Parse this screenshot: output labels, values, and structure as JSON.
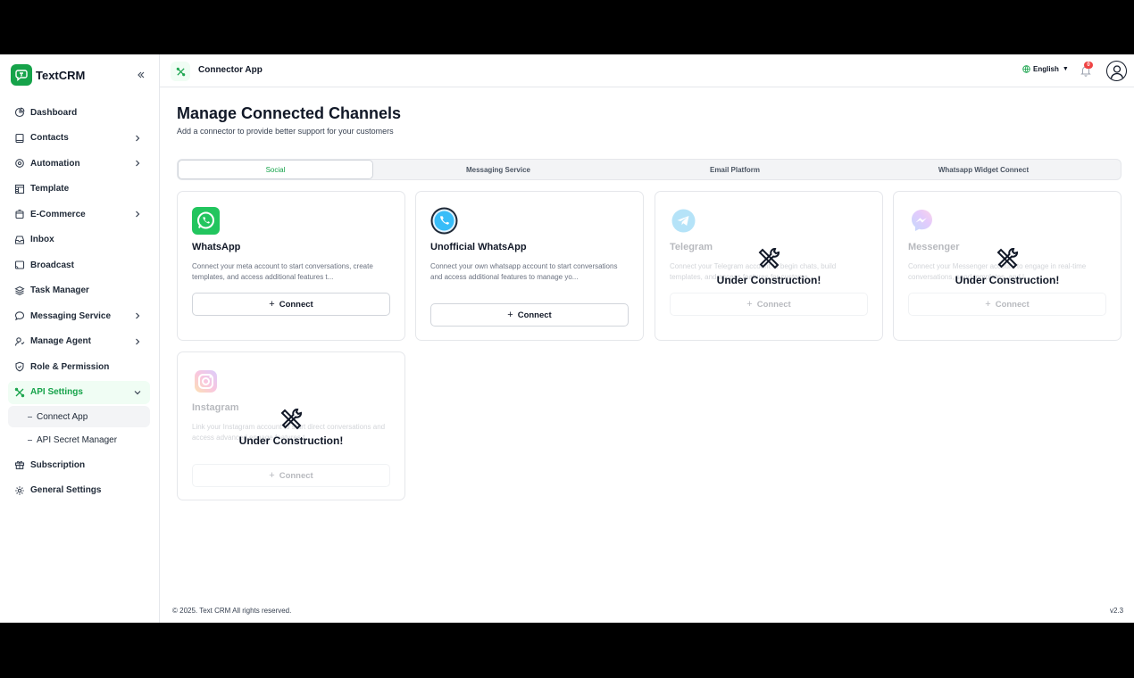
{
  "app": {
    "name": "TextCRM"
  },
  "sidebar": {
    "items": [
      {
        "label": "Dashboard",
        "icon": "dashboard-icon",
        "has_children": false
      },
      {
        "label": "Contacts",
        "icon": "contacts-icon",
        "has_children": true
      },
      {
        "label": "Automation",
        "icon": "automation-icon",
        "has_children": true
      },
      {
        "label": "Template",
        "icon": "template-icon",
        "has_children": false
      },
      {
        "label": "E-Commerce",
        "icon": "ecommerce-icon",
        "has_children": true
      },
      {
        "label": "Inbox",
        "icon": "inbox-icon",
        "has_children": false
      },
      {
        "label": "Broadcast",
        "icon": "broadcast-icon",
        "has_children": false
      },
      {
        "label": "Task Manager",
        "icon": "task-manager-icon",
        "has_children": false
      },
      {
        "label": "Messaging Service",
        "icon": "messaging-icon",
        "has_children": true
      },
      {
        "label": "Manage Agent",
        "icon": "agent-icon",
        "has_children": true
      },
      {
        "label": "Role & Permission",
        "icon": "shield-icon",
        "has_children": false
      },
      {
        "label": "API Settings",
        "icon": "api-settings-icon",
        "has_children": true,
        "active": true
      },
      {
        "label": "Subscription",
        "icon": "gift-icon",
        "has_children": false
      },
      {
        "label": "General Settings",
        "icon": "gear-icon",
        "has_children": false
      }
    ],
    "sub_items": [
      {
        "label": "Connect App",
        "active": true
      },
      {
        "label": "API Secret Manager",
        "active": false
      }
    ]
  },
  "topbar": {
    "title": "Connector App",
    "language": "English",
    "notification_count": "0"
  },
  "main": {
    "title": "Manage Connected Channels",
    "subtitle": "Add a connector to provide better support for your customers",
    "tabs": [
      {
        "label": "Social",
        "active": true
      },
      {
        "label": "Messaging Service",
        "active": false
      },
      {
        "label": "Email Platform",
        "active": false
      },
      {
        "label": "Whatsapp Widget Connect",
        "active": false
      }
    ],
    "connect_label": "Connect",
    "under_construction_label": "Under Construction!",
    "cards": [
      {
        "name": "WhatsApp",
        "desc": "Connect your meta account to start conversations, create templates, and access additional features t...",
        "icon": "whatsapp-icon",
        "status": "available"
      },
      {
        "name": "Unofficial WhatsApp",
        "desc": "Connect your own whatsapp account to start conversations and access additional features to manage yo...",
        "icon": "whatsapp-unofficial-icon",
        "status": "available"
      },
      {
        "name": "Telegram",
        "desc": "Connect your Telegram account to begin chats, build templates, and access features for custome...",
        "icon": "telegram-icon",
        "status": "under-construction"
      },
      {
        "name": "Messenger",
        "desc": "Connect your Messenger account to engage in real-time conversations, send templates, and l...",
        "icon": "messenger-icon",
        "status": "under-construction"
      },
      {
        "name": "Instagram",
        "desc": "Link your Instagram account to start direct conversations and access advanced engage features t...",
        "icon": "instagram-icon",
        "status": "under-construction"
      }
    ]
  },
  "footer": {
    "copyright": "© 2025. Text CRM All rights reserved.",
    "version": "v2.3"
  },
  "colors": {
    "brand": "#16a34a",
    "active_bg": "#f0fdf4",
    "badge": "#ef4444"
  }
}
